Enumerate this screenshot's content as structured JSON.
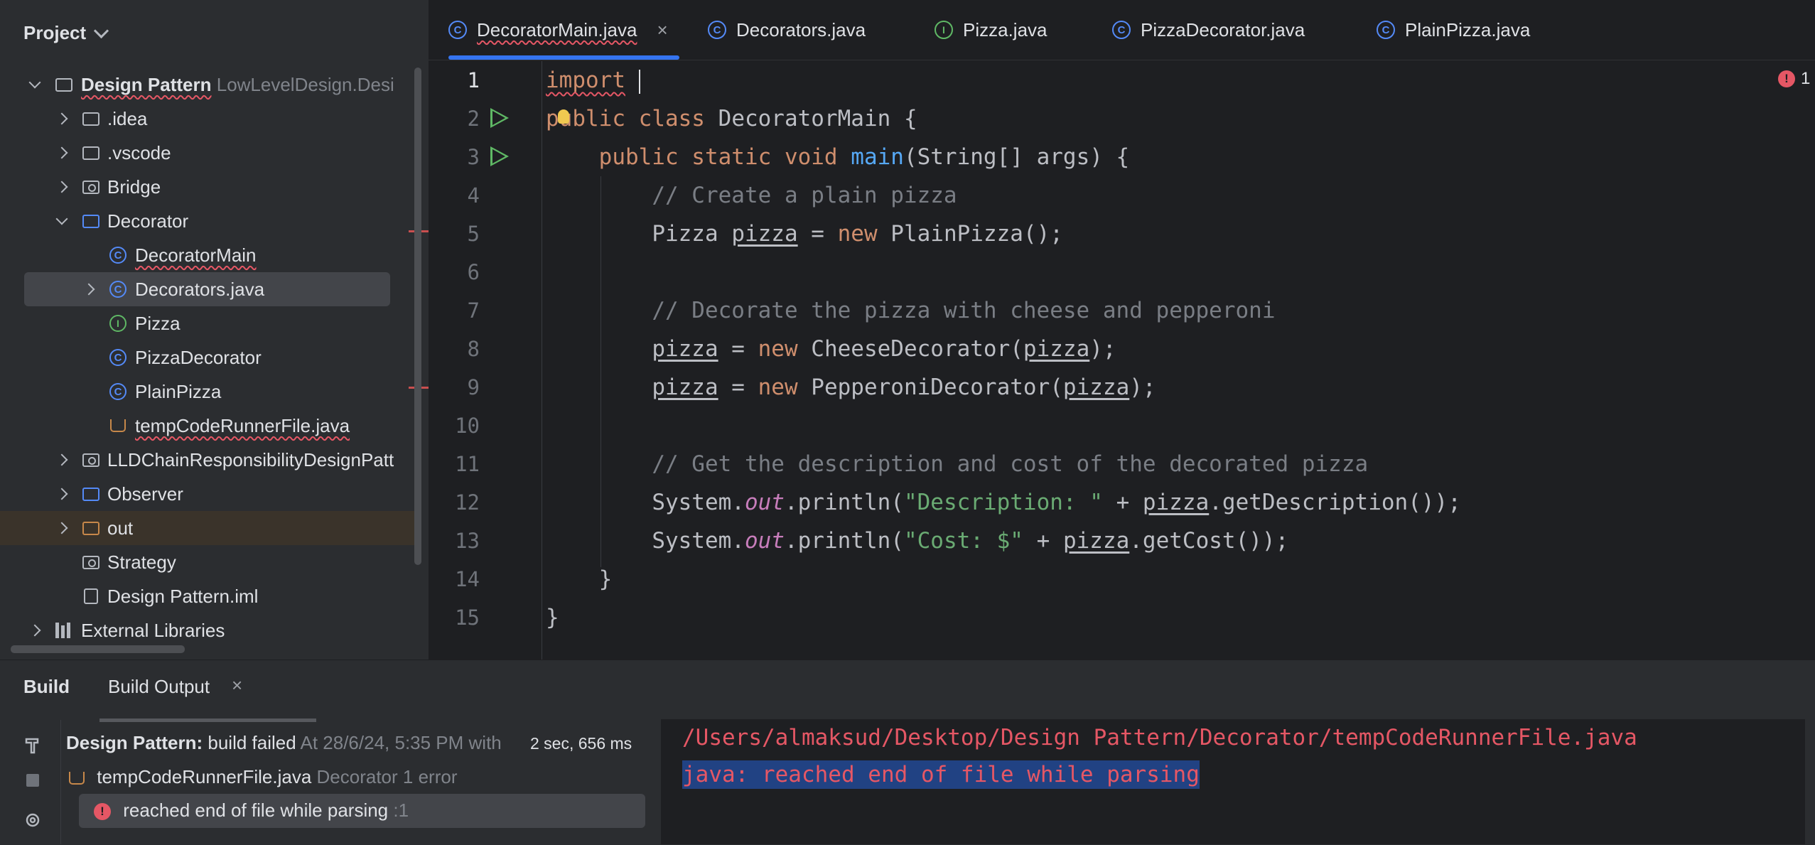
{
  "project": {
    "title": "Project",
    "root_name": "Design Pattern",
    "root_path": "LowLevelDesign.Desi",
    "items": [
      {
        "label": ".idea"
      },
      {
        "label": ".vscode"
      },
      {
        "label": "Bridge"
      },
      {
        "label": "Decorator"
      },
      {
        "label": "DecoratorMain"
      },
      {
        "label": "Decorators.java"
      },
      {
        "label": "Pizza"
      },
      {
        "label": "PizzaDecorator"
      },
      {
        "label": "PlainPizza"
      },
      {
        "label": "tempCodeRunnerFile.java"
      },
      {
        "label": "LLDChainResponsibilityDesignPatt"
      },
      {
        "label": "Observer"
      },
      {
        "label": "out"
      },
      {
        "label": "Strategy"
      },
      {
        "label": "Design Pattern.iml"
      }
    ],
    "external_libraries": "External Libraries"
  },
  "tabs": [
    {
      "label": "DecoratorMain.java",
      "close": "×"
    },
    {
      "label": "Decorators.java"
    },
    {
      "label": "Pizza.java"
    },
    {
      "label": "PizzaDecorator.java"
    },
    {
      "label": "PlainPizza.java"
    }
  ],
  "editor": {
    "line_numbers": [
      "1",
      "2",
      "3",
      "4",
      "5",
      "6",
      "7",
      "8",
      "9",
      "10",
      "11",
      "12",
      "13",
      "14",
      "15"
    ],
    "error_count": "1",
    "code": {
      "l1": "import",
      "l2_kw1": "public",
      "l2_kw2": "class",
      "l2_rest": "DecoratorMain {",
      "l3_kw": "public static void",
      "l3_fn": "main",
      "l3_rest": "(String[] args) {",
      "l4": "// Create a plain pizza",
      "l5_type": "Pizza",
      "l5_var": "pizza",
      "l5_eq": " = ",
      "l5_new": "new",
      "l5_rest": " PlainPizza();",
      "l7": "// Decorate the pizza with cheese and pepperoni",
      "l8_var": "pizza",
      "l8_eq": " = ",
      "l8_new": "new",
      "l8_mid": " CheeseDecorator(",
      "l8_arg": "pizza",
      "l8_end": ");",
      "l9_var": "pizza",
      "l9_eq": " = ",
      "l9_new": "new",
      "l9_mid": " PepperoniDecorator(",
      "l9_arg": "pizza",
      "l9_end": ");",
      "l11": "// Get the description and cost of the decorated pizza",
      "l12_a": "System.",
      "l12_out": "out",
      "l12_b": ".println(",
      "l12_str": "\"Description: \"",
      "l12_c": " + ",
      "l12_var": "pizza",
      "l12_d": ".getDescription());",
      "l13_a": "System.",
      "l13_out": "out",
      "l13_b": ".println(",
      "l13_str": "\"Cost: $\"",
      "l13_c": " + ",
      "l13_var": "pizza",
      "l13_d": ".getCost());",
      "l14": "}",
      "l15": "}"
    }
  },
  "build": {
    "tab_build": "Build",
    "tab_output": "Build Output",
    "tab_close": "×",
    "summary_bold": "Design Pattern:",
    "summary_status": "build failed",
    "summary_time": "At 28/6/24, 5:35 PM with",
    "summary_duration": "2 sec, 656 ms",
    "file_name": "tempCodeRunnerFile.java",
    "file_meta": "Decorator 1 error",
    "error_msg": "reached end of file while parsing",
    "error_loc": ":1",
    "console_line1": "/Users/almaksud/Desktop/Design Pattern/Decorator/tempCodeRunnerFile.java",
    "console_line2": "java: reached end of file while parsing"
  },
  "colors": {
    "background": "#1e1f22",
    "panel": "#2b2d30",
    "accent": "#3574f0",
    "error": "#e55765",
    "keyword": "#cf8e6d",
    "string": "#6aab73"
  }
}
